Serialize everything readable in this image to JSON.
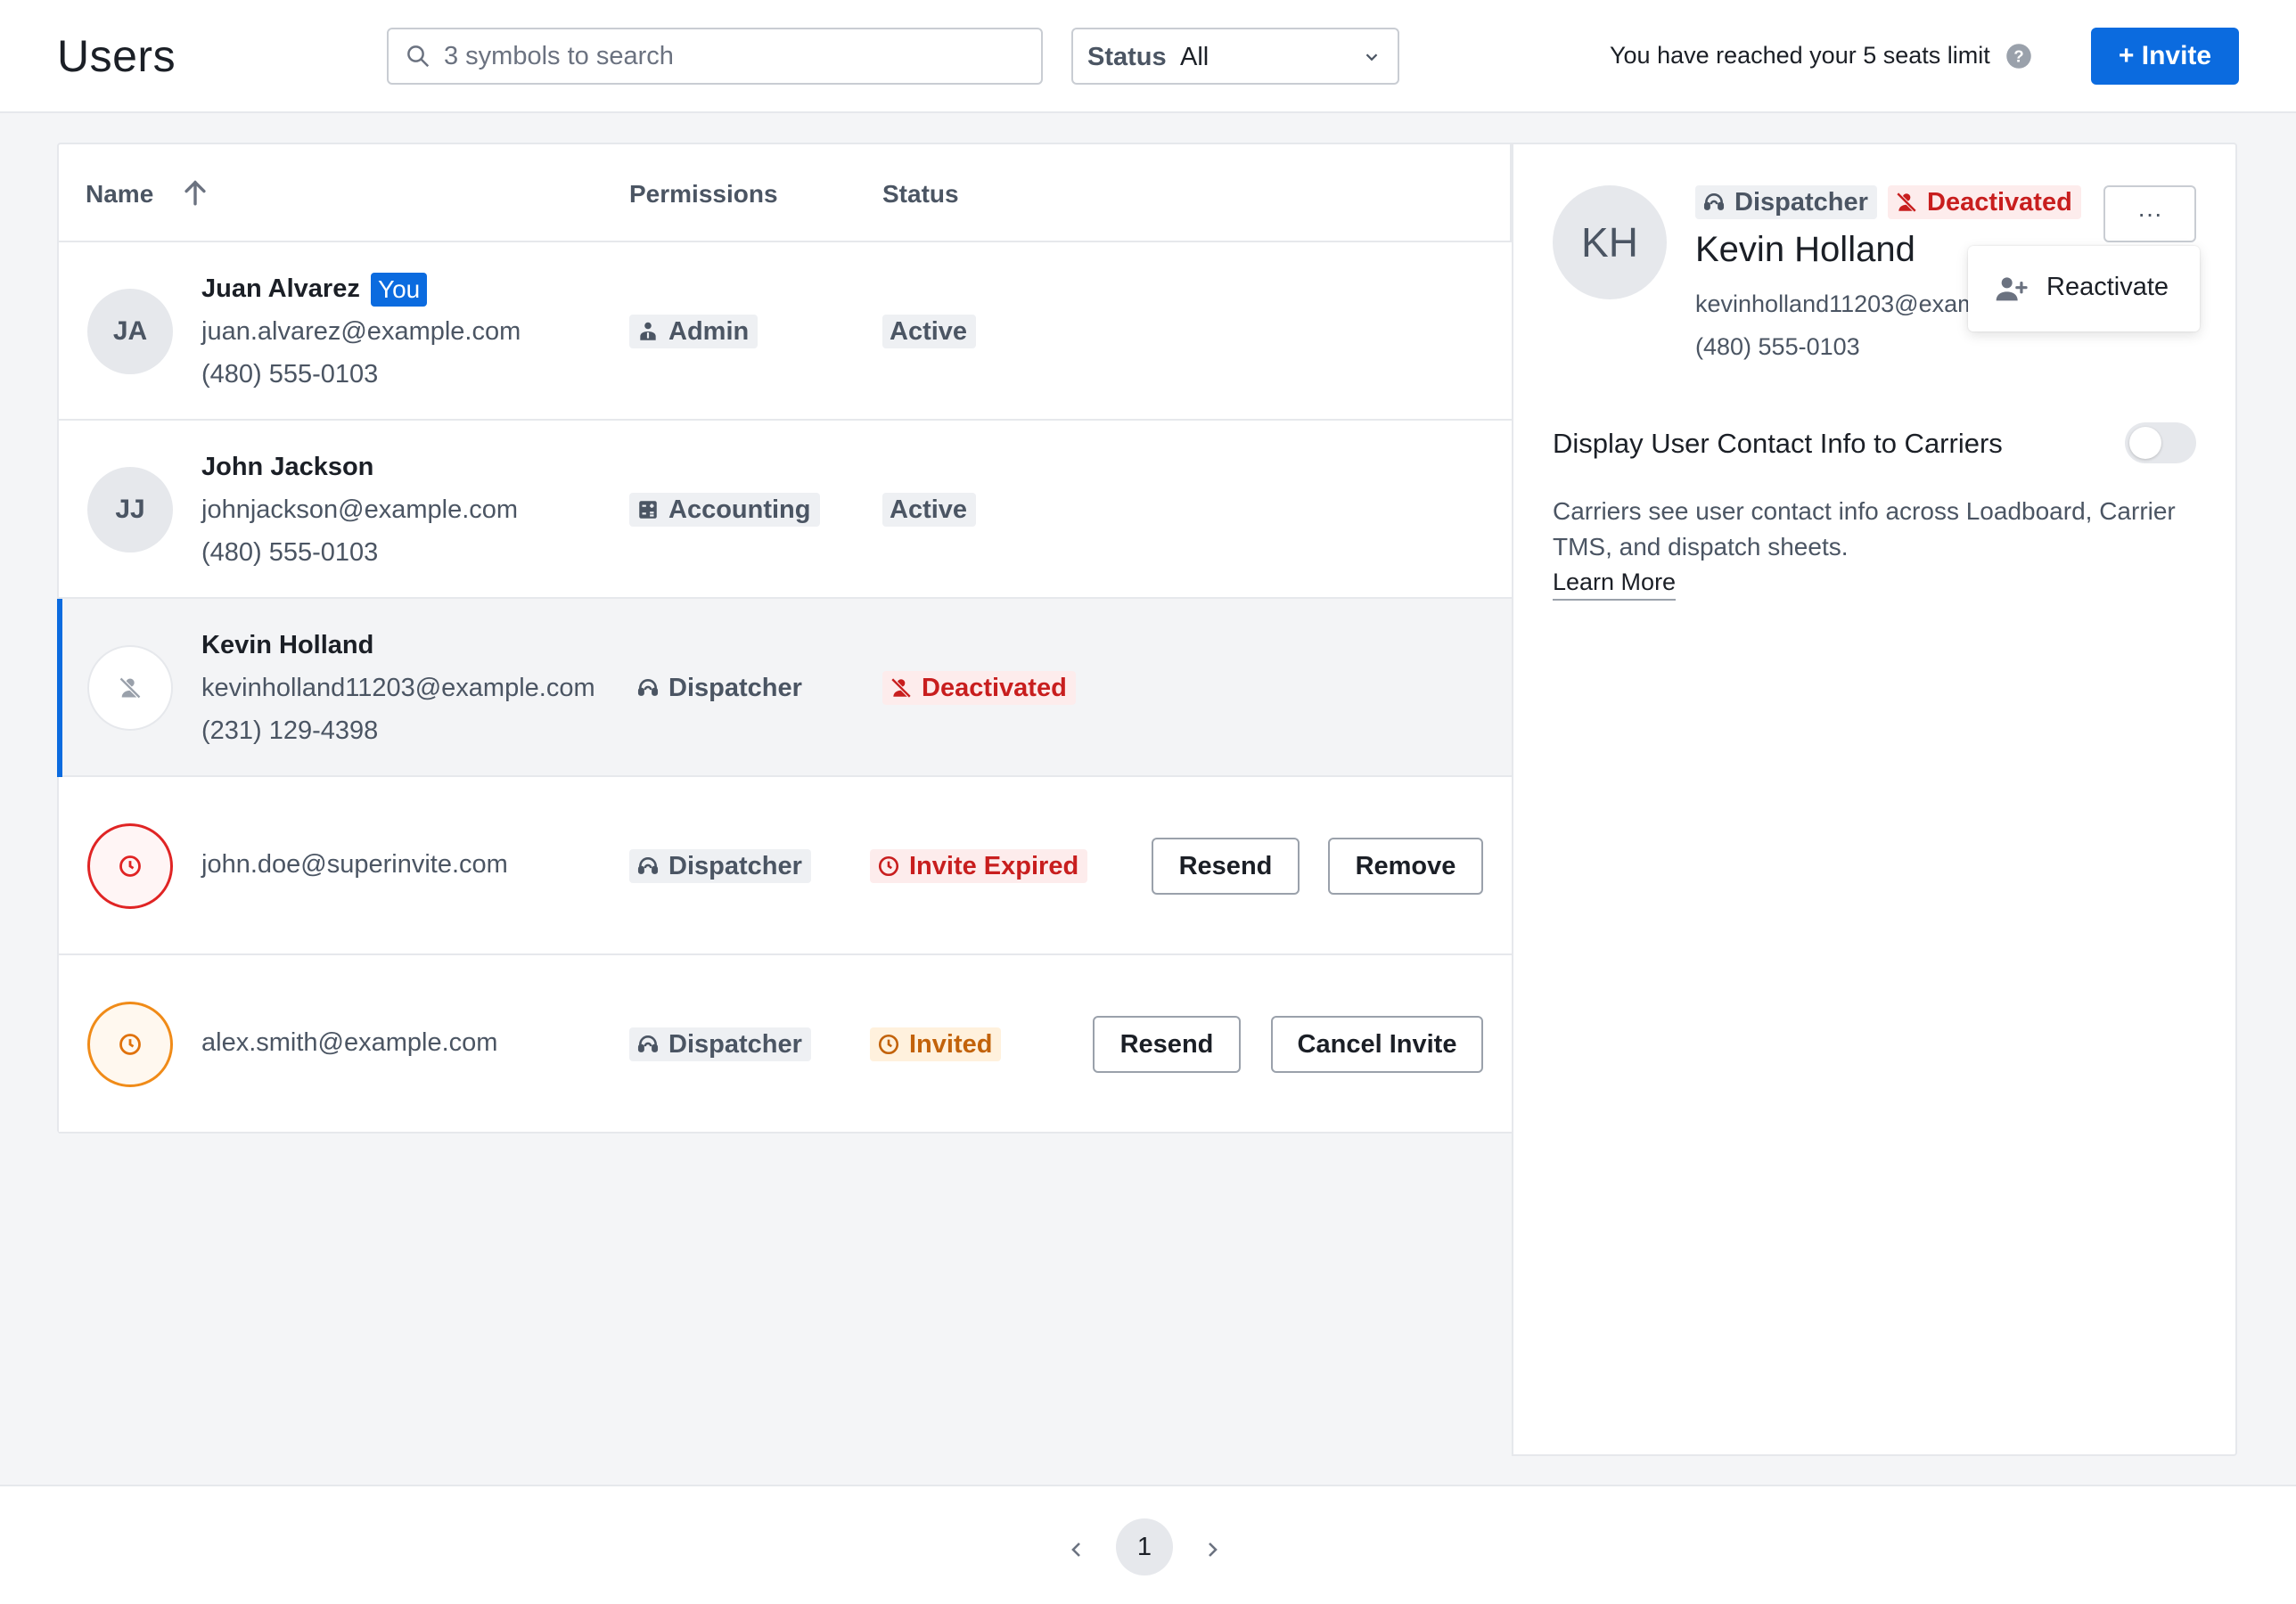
{
  "header": {
    "title": "Users",
    "search_placeholder": "3 symbols to search",
    "status_filter_label": "Status",
    "status_filter_value": "All",
    "seats_text": "You have reached your 5 seats limit",
    "invite_label": "+ Invite",
    "accent_color": "#0b6bdf"
  },
  "table": {
    "columns": {
      "name": "Name",
      "permissions": "Permissions",
      "status": "Status"
    },
    "rows": [
      {
        "initials": "JA",
        "name": "Juan Alvarez",
        "badge": "You",
        "email": "juan.alvarez@example.com",
        "phone": "(480) 555-0103",
        "permission": "Admin",
        "permission_icon": "admin-icon",
        "status": "Active"
      },
      {
        "initials": "JJ",
        "name": "John Jackson",
        "email": "johnjackson@example.com",
        "phone": "(480) 555-0103",
        "permission": "Accounting",
        "permission_icon": "calculator-icon",
        "status": "Active"
      },
      {
        "name": "Kevin Holland",
        "email": "kevinholland11203@example.com",
        "phone": "(231) 129-4398",
        "permission": "Dispatcher",
        "permission_icon": "headset-icon",
        "status": "Deactivated",
        "status_icon": "user-off-icon"
      },
      {
        "email": "john.doe@superinvite.com",
        "permission": "Dispatcher",
        "permission_icon": "headset-icon",
        "status": "Invite Expired",
        "status_icon": "clock-icon",
        "actions": [
          "Resend",
          "Remove"
        ]
      },
      {
        "email": "alex.smith@example.com",
        "permission": "Dispatcher",
        "permission_icon": "headset-icon",
        "status": "Invited",
        "status_icon": "clock-icon",
        "actions": [
          "Resend",
          "Cancel Invite"
        ]
      }
    ]
  },
  "panel": {
    "initials": "KH",
    "role": "Dispatcher",
    "status": "Deactivated",
    "name": "Kevin Holland",
    "email": "kevinholland11203@example.com",
    "phone": "(480) 555-0103",
    "more_label": "···",
    "menu_item": "Reactivate",
    "toggle_label": "Display User Contact Info to Carriers",
    "toggle_on": false,
    "description": "Carriers see user contact info across Loadboard, Carrier TMS, and dispatch sheets.",
    "learn_more": "Learn More"
  },
  "pagination": {
    "current_page": "1"
  },
  "colors": {
    "danger": "#c81e1e",
    "warning": "#c2620a",
    "muted": "#4b5563"
  }
}
